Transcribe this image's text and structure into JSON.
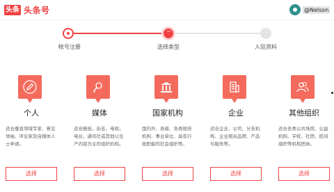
{
  "header": {
    "logo_box": "头条",
    "logo_text": "头条号",
    "user_name": "@Nelson"
  },
  "steps": [
    {
      "label": "帐号注册",
      "state": "done"
    },
    {
      "label": "选择类型",
      "state": "current",
      "glyph": "···"
    },
    {
      "label": "入驻资料",
      "state": "todo"
    }
  ],
  "cards": [
    {
      "title": "个人",
      "icon": "pencil-icon",
      "desc": "适合垂直领域专家、意见领袖、评论家及自媒体人士申请。",
      "button": "选择"
    },
    {
      "title": "媒体",
      "icon": "microphone-icon",
      "desc": "适合报纸，杂志，电视，电台，通讯社或其他以生产内容为主的组织机构。",
      "button": "选择"
    },
    {
      "title": "国家机构",
      "icon": "government-building-icon",
      "desc": "国内外、各级、各类政府机构、事业单位、具有行政职能的社会组织等。",
      "button": "选择"
    },
    {
      "title": "企业",
      "icon": "company-building-icon",
      "desc": "适合企业、公司、分支机构、企业相关品牌、产品与服务等。",
      "button": "选择"
    },
    {
      "title": "其他组织",
      "icon": "people-icon",
      "desc": "适合各类公共场馆、公益机构、学校、社团、民间组织等机构团体。",
      "button": "选择"
    }
  ],
  "colors": {
    "accent": "#f04142",
    "icon_bg": "#f46b5d"
  }
}
